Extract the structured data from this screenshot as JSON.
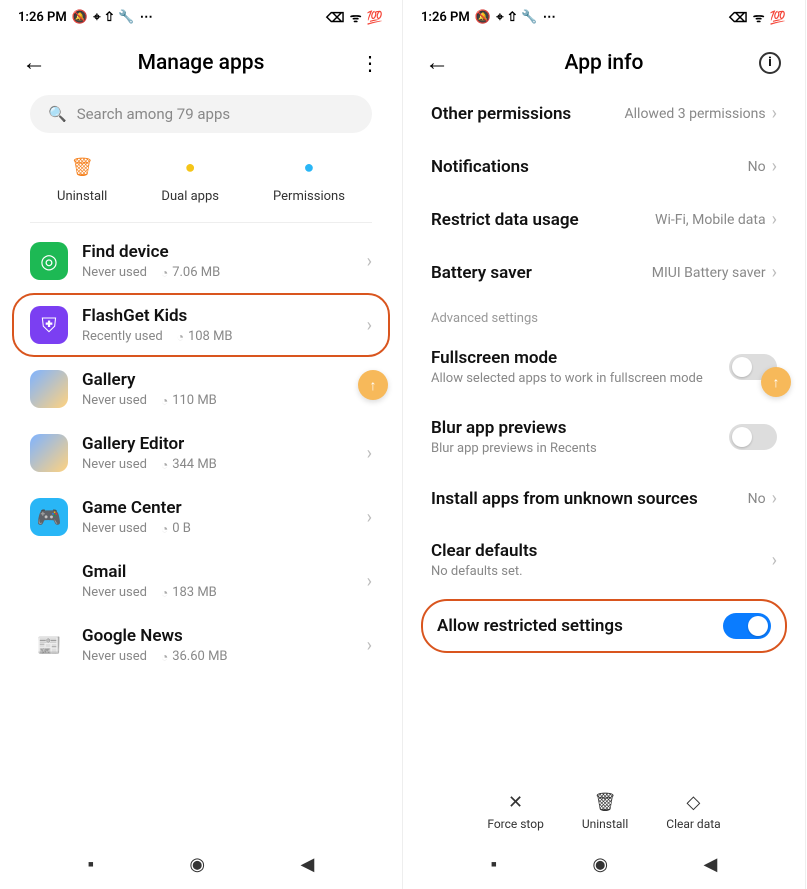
{
  "status": {
    "time": "1:26 PM",
    "icons_left": "🔕 ⌖ ⇧ 🔧 ⋯",
    "icons_right": "⌫ ᯤ 💯"
  },
  "left": {
    "title": "Manage apps",
    "search_placeholder": "Search among 79 apps",
    "actions": [
      {
        "label": "Uninstall",
        "icon": "🗑",
        "color": "#f58220"
      },
      {
        "label": "Dual apps",
        "icon": "●",
        "color": "#f5c518"
      },
      {
        "label": "Permissions",
        "icon": "●",
        "color": "#29b6f6"
      }
    ],
    "apps": [
      {
        "name": "Find device",
        "usage": "Never used",
        "size": "7.06 MB",
        "bg": "#1db954",
        "ic": "◎",
        "hl": false
      },
      {
        "name": "FlashGet Kids",
        "usage": "Recently used",
        "size": "108 MB",
        "bg": "#7b3ff2",
        "ic": "⛨",
        "hl": true
      },
      {
        "name": "Gallery",
        "usage": "Never used",
        "size": "110 MB",
        "bg": "linear-gradient(135deg,#7fb3ff,#ffd27f)",
        "ic": "",
        "hl": false
      },
      {
        "name": "Gallery Editor",
        "usage": "Never used",
        "size": "344 MB",
        "bg": "linear-gradient(135deg,#7fb3ff,#ffd27f)",
        "ic": "",
        "hl": false
      },
      {
        "name": "Game Center",
        "usage": "Never used",
        "size": "0 B",
        "bg": "#29b6f6",
        "ic": "🎮",
        "hl": false
      },
      {
        "name": "Gmail",
        "usage": "Never used",
        "size": "183 MB",
        "bg": "#fff",
        "ic": "M",
        "hl": false
      },
      {
        "name": "Google News",
        "usage": "Never used",
        "size": "36.60 MB",
        "bg": "#fff",
        "ic": "📰",
        "hl": false
      }
    ]
  },
  "right": {
    "title": "App info",
    "rows": [
      {
        "label": "Other permissions",
        "value": "Allowed 3 permissions",
        "chev": true
      },
      {
        "label": "Notifications",
        "value": "No",
        "chev": true
      },
      {
        "label": "Restrict data usage",
        "value": "Wi-Fi, Mobile data",
        "chev": true
      },
      {
        "label": "Battery saver",
        "value": "MIUI Battery saver",
        "chev": true
      }
    ],
    "section": "Advanced settings",
    "adv": [
      {
        "label": "Fullscreen mode",
        "sub": "Allow selected apps to work in fullscreen mode",
        "toggle": false
      },
      {
        "label": "Blur app previews",
        "sub": "Blur app previews in Recents",
        "toggle": false
      },
      {
        "label": "Install apps from unknown sources",
        "value": "No",
        "chev": true
      },
      {
        "label": "Clear defaults",
        "sub": "No defaults set.",
        "chev": true
      },
      {
        "label": "Allow restricted settings",
        "toggle": true,
        "hl": true
      }
    ],
    "bottom": [
      {
        "label": "Force stop",
        "icon": "✕"
      },
      {
        "label": "Uninstall",
        "icon": "🗑"
      },
      {
        "label": "Clear data",
        "icon": "◇"
      }
    ]
  }
}
